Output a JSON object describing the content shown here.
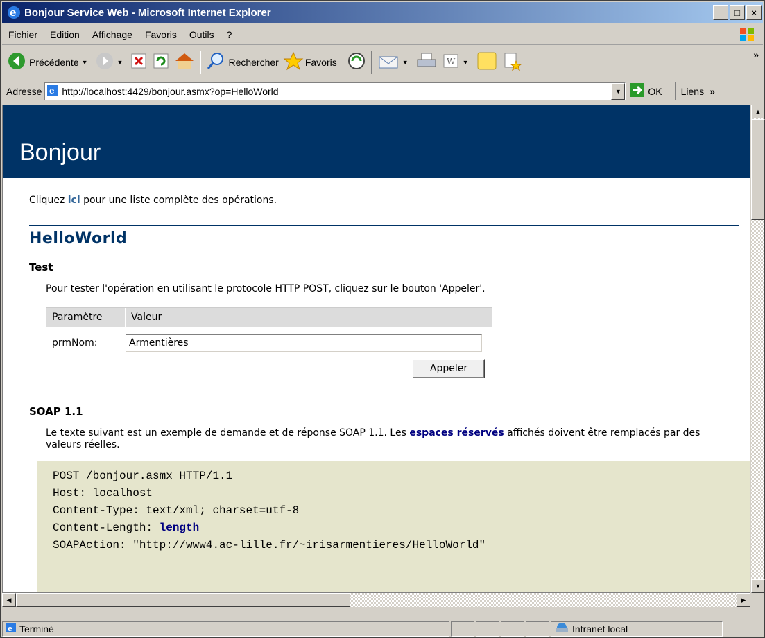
{
  "window": {
    "title": "Bonjour Service Web - Microsoft Internet Explorer",
    "controls": [
      "_",
      "□",
      "×"
    ]
  },
  "menu": [
    "Fichier",
    "Edition",
    "Affichage",
    "Favoris",
    "Outils",
    "?"
  ],
  "toolbar": {
    "back_label": "Précédente",
    "search_label": "Rechercher",
    "favorites_label": "Favoris"
  },
  "address": {
    "label": "Adresse",
    "url": "http://localhost:4429/bonjour.asmx?op=HelloWorld",
    "go_label": "OK",
    "links_label": "Liens"
  },
  "page": {
    "heading": "Bonjour",
    "intro_before": "Cliquez ",
    "intro_link": "ici",
    "intro_after": " pour une liste complète des opérations.",
    "operation": "HelloWorld",
    "test_heading": "Test",
    "test_text": "Pour tester l'opération en utilisant le protocole HTTP POST, cliquez sur le bouton 'Appeler'.",
    "param_col": "Paramètre",
    "value_col": "Valeur",
    "param_name": "prmNom:",
    "param_value": "Armentières",
    "invoke_label": "Appeler",
    "soap_heading": "SOAP 1.1",
    "soap_text_before": "Le texte suivant est un exemple de demande et de réponse SOAP 1.1. Les ",
    "soap_text_bold": "espaces réservés",
    "soap_text_after": " affichés doivent être remplacés par des valeurs réelles.",
    "code_lines": [
      "POST /bonjour.asmx HTTP/1.1",
      "Host: localhost",
      "Content-Type: text/xml; charset=utf-8"
    ],
    "code_len_prefix": "Content-Length: ",
    "code_len_bold": "length",
    "code_partial": "SOAPAction: \"http://www4.ac-lille.fr/~irisarmentieres/HelloWorld\""
  },
  "status": {
    "text": "Terminé",
    "zone": "Intranet local"
  },
  "colors": {
    "title_gradient_start": "#0a246a",
    "page_band": "#003366",
    "code_bg": "#e5e5cc"
  }
}
